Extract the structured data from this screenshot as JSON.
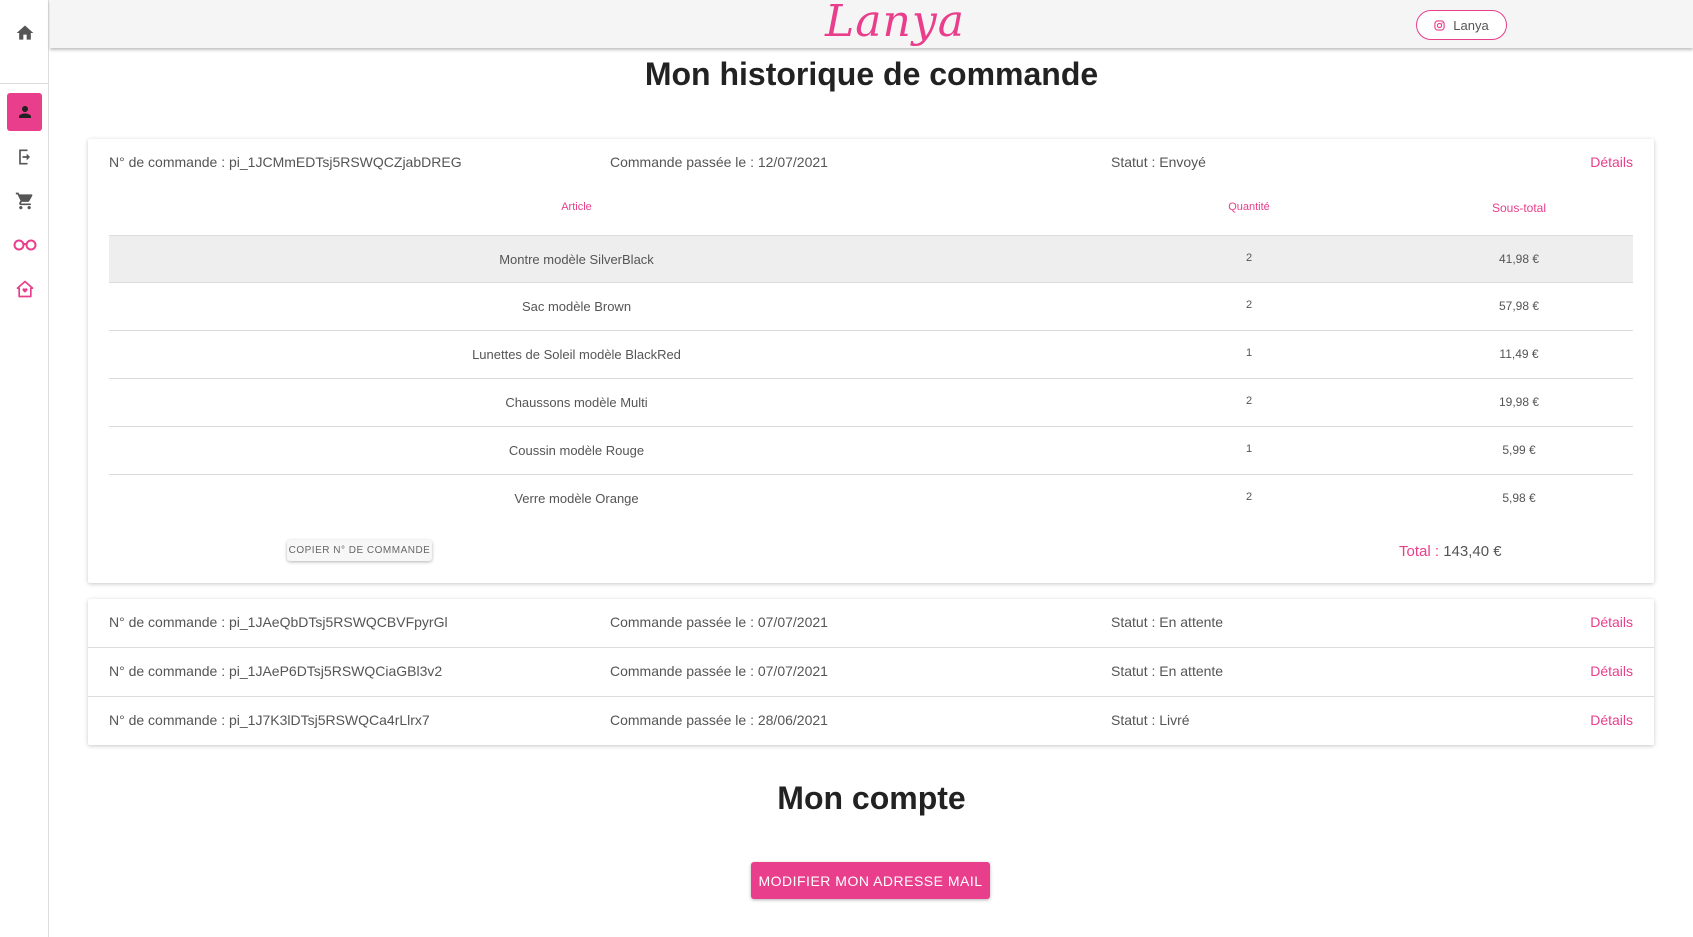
{
  "brand": {
    "logo": "Lanya",
    "instagram_label": "Lanya",
    "accent": "#e83e8c"
  },
  "sidebar": {
    "items": [
      {
        "name": "home-icon"
      },
      {
        "name": "user-icon",
        "active": true
      },
      {
        "name": "logout-icon"
      },
      {
        "name": "cart-icon"
      },
      {
        "name": "glasses-icon"
      },
      {
        "name": "house-heart-icon"
      }
    ]
  },
  "page_title": "Mon historique de commande",
  "orders": [
    {
      "number": "N° de commande : pi_1JCMmEDTsj5RSWQCZjabDREG",
      "date": "Commande passée le : 12/07/2021",
      "status": "Statut : Envoyé",
      "details": "Détails",
      "headers": {
        "article": "Article",
        "quantity": "Quantité",
        "subtotal": "Sous-total"
      },
      "items": [
        {
          "article": "Montre modèle SilverBlack",
          "quantity": "2",
          "subtotal": "41,98 €"
        },
        {
          "article": "Sac modèle Brown",
          "quantity": "2",
          "subtotal": "57,98 €"
        },
        {
          "article": "Lunettes de Soleil modèle BlackRed",
          "quantity": "1",
          "subtotal": "11,49 €"
        },
        {
          "article": "Chaussons modèle Multi",
          "quantity": "2",
          "subtotal": "19,98 €"
        },
        {
          "article": "Coussin modèle Rouge",
          "quantity": "1",
          "subtotal": "5,99 €"
        },
        {
          "article": "Verre modèle Orange",
          "quantity": "2",
          "subtotal": "5,98 €"
        }
      ],
      "copy_button": "COPIER N° DE COMMANDE",
      "total_label": "Total :",
      "total_value": "143,40 €"
    },
    {
      "number": "N° de commande : pi_1JAeQbDTsj5RSWQCBVFpyrGl",
      "date": "Commande passée le : 07/07/2021",
      "status": "Statut : En attente",
      "details": "Détails"
    },
    {
      "number": "N° de commande : pi_1JAeP6DTsj5RSWQCiaGBl3v2",
      "date": "Commande passée le : 07/07/2021",
      "status": "Statut : En attente",
      "details": "Détails"
    },
    {
      "number": "N° de commande : pi_1J7K3lDTsj5RSWQCa4rLlrx7",
      "date": "Commande passée le : 28/06/2021",
      "status": "Statut : Livré",
      "details": "Détails"
    }
  ],
  "account": {
    "title": "Mon compte",
    "button": "MODIFIER MON ADRESSE MAIL"
  }
}
